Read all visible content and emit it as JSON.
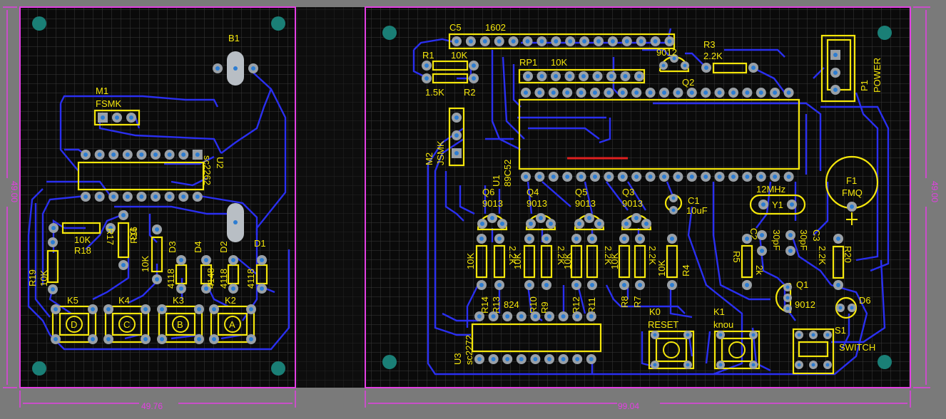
{
  "colors": {
    "background": "#7a7a7a",
    "board": "#0a0a0a",
    "grid": "#3a3a3a",
    "board_outline": "#e33fe3",
    "trace": "#2a2ff0",
    "silkscreen": "#f4e60a",
    "pad": "#9aa0a6",
    "via": "#2d7dd2",
    "mounting_hole": "#1a7f76",
    "jumper": "#e02020"
  },
  "dimensions": {
    "left_board_width": "49.76",
    "right_board_width": "99.04",
    "left_board_height": "49.00",
    "right_board_height": "49.00"
  },
  "left_board": {
    "labels": [
      {
        "key": "b1",
        "text": "B1"
      },
      {
        "key": "m1",
        "text": "M1"
      },
      {
        "key": "fsmk",
        "text": "FSMK"
      },
      {
        "key": "u2",
        "text": "U2"
      },
      {
        "key": "sc2262",
        "text": "sc2262"
      },
      {
        "key": "r18v",
        "text": "10K"
      },
      {
        "key": "r18",
        "text": "R18"
      },
      {
        "key": "r17",
        "text": "R17"
      },
      {
        "key": "r16",
        "text": "R16"
      },
      {
        "key": "r16v",
        "text": "10K"
      },
      {
        "key": "r17v",
        "text": "10K"
      },
      {
        "key": "r19",
        "text": "R19"
      },
      {
        "key": "r19v",
        "text": "10K"
      },
      {
        "key": "d1",
        "text": "D1"
      },
      {
        "key": "d2",
        "text": "D2"
      },
      {
        "key": "d3",
        "text": "D3"
      },
      {
        "key": "d4",
        "text": "D4"
      },
      {
        "key": "d1v",
        "text": "4118"
      },
      {
        "key": "d2v",
        "text": "4118"
      },
      {
        "key": "d3v",
        "text": "4118"
      },
      {
        "key": "d4v",
        "text": "4148"
      },
      {
        "key": "k5",
        "text": "K5"
      },
      {
        "key": "k4",
        "text": "K4"
      },
      {
        "key": "k3",
        "text": "K3"
      },
      {
        "key": "k2",
        "text": "K2"
      }
    ],
    "buttons": [
      {
        "key": "k5",
        "ref": "K5",
        "letter": "D"
      },
      {
        "key": "k4",
        "ref": "K4",
        "letter": "C"
      },
      {
        "key": "k3",
        "ref": "K3",
        "letter": "B"
      },
      {
        "key": "k2",
        "ref": "K2",
        "letter": "A"
      }
    ]
  },
  "right_board": {
    "labels": [
      {
        "key": "c5",
        "text": "C5"
      },
      {
        "key": "lcd",
        "text": "1602"
      },
      {
        "key": "r1",
        "text": "R1"
      },
      {
        "key": "r1v",
        "text": "10K"
      },
      {
        "key": "r2",
        "text": "R2"
      },
      {
        "key": "r2v",
        "text": "1.5K"
      },
      {
        "key": "rp1",
        "text": "RP1"
      },
      {
        "key": "rp1v",
        "text": "10K"
      },
      {
        "key": "q2v",
        "text": "9012"
      },
      {
        "key": "q2",
        "text": "Q2"
      },
      {
        "key": "r3",
        "text": "R3"
      },
      {
        "key": "r3v",
        "text": "2.2K"
      },
      {
        "key": "p1",
        "text": "P1"
      },
      {
        "key": "power",
        "text": "POWER"
      },
      {
        "key": "m2",
        "text": "M2"
      },
      {
        "key": "jsmk",
        "text": "JSMK"
      },
      {
        "key": "u1",
        "text": "U1"
      },
      {
        "key": "u1v",
        "text": "89C52"
      },
      {
        "key": "q6",
        "text": "Q6"
      },
      {
        "key": "q4",
        "text": "Q4"
      },
      {
        "key": "q5",
        "text": "Q5"
      },
      {
        "key": "q3",
        "text": "Q3"
      },
      {
        "key": "q6v",
        "text": "9013"
      },
      {
        "key": "q4v",
        "text": "9013"
      },
      {
        "key": "q5v",
        "text": "9013"
      },
      {
        "key": "q3v",
        "text": "9013"
      },
      {
        "key": "c1",
        "text": "C1"
      },
      {
        "key": "c1v",
        "text": "10uF"
      },
      {
        "key": "y1f",
        "text": "12MHz"
      },
      {
        "key": "y1",
        "text": "Y1"
      },
      {
        "key": "f1",
        "text": "F1"
      },
      {
        "key": "fmq",
        "text": "FMQ"
      },
      {
        "key": "c2",
        "text": "C2"
      },
      {
        "key": "c2v",
        "text": "30pF"
      },
      {
        "key": "c3",
        "text": "C3"
      },
      {
        "key": "c3v",
        "text": "30pF"
      },
      {
        "key": "r5",
        "text": "R5"
      },
      {
        "key": "r5v",
        "text": "2k"
      },
      {
        "key": "r20",
        "text": "R20"
      },
      {
        "key": "r20v",
        "text": "2.2K"
      },
      {
        "key": "r14",
        "text": "R14"
      },
      {
        "key": "r13",
        "text": "R13"
      },
      {
        "key": "r14v",
        "text": "10K"
      },
      {
        "key": "r13v",
        "text": "2.2K"
      },
      {
        "key": "r10",
        "text": "R10"
      },
      {
        "key": "r9",
        "text": "R9"
      },
      {
        "key": "r10v",
        "text": "10K"
      },
      {
        "key": "r9v",
        "text": "2.2K"
      },
      {
        "key": "r12",
        "text": "R12"
      },
      {
        "key": "r11",
        "text": "R11"
      },
      {
        "key": "r12v",
        "text": "10K"
      },
      {
        "key": "r11v",
        "text": "2.2K"
      },
      {
        "key": "r8",
        "text": "R8"
      },
      {
        "key": "r7",
        "text": "R7"
      },
      {
        "key": "r8v",
        "text": "10K"
      },
      {
        "key": "r7v",
        "text": "2.2K"
      },
      {
        "key": "r4",
        "text": "R4"
      },
      {
        "key": "r4v",
        "text": "10K"
      },
      {
        "key": "q1",
        "text": "Q1"
      },
      {
        "key": "q1v",
        "text": "9012"
      },
      {
        "key": "d6",
        "text": "D6"
      },
      {
        "key": "s1",
        "text": "S1"
      },
      {
        "key": "switch",
        "text": "SWITCH"
      },
      {
        "key": "k0",
        "text": "K0"
      },
      {
        "key": "reset",
        "text": "RESET"
      },
      {
        "key": "k1",
        "text": "K1"
      },
      {
        "key": "knou",
        "text": "knou"
      },
      {
        "key": "u3",
        "text": "U3"
      },
      {
        "key": "sc2272",
        "text": "sc2272"
      },
      {
        "key": "r824",
        "text": "824"
      }
    ]
  }
}
